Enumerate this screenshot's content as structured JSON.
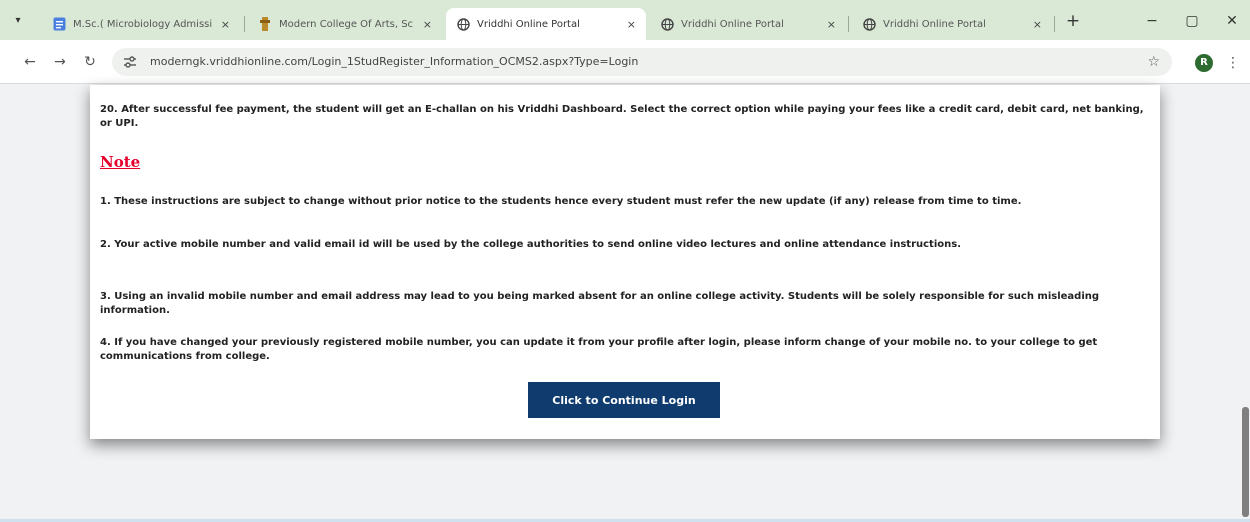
{
  "browser": {
    "tabs": [
      {
        "title": "M.Sc.( Microbiology Admissi",
        "favicon": "doc-icon"
      },
      {
        "title": "Modern College Of Arts, Sc",
        "favicon": "college-logo-icon"
      },
      {
        "title": "Vriddhi Online Portal",
        "favicon": "globe-icon",
        "active": true
      },
      {
        "title": "Vriddhi Online Portal",
        "favicon": "globe-icon"
      },
      {
        "title": "Vriddhi Online Portal",
        "favicon": "globe-icon"
      }
    ],
    "new_tab_label": "+",
    "tab_close_label": "×",
    "tab_dropdown_label": "▾",
    "minimize_label": "−",
    "maximize_label": "▢",
    "close_label": "✕",
    "back_label": "←",
    "forward_label": "→",
    "reload_label": "↻",
    "url": "moderngk.vriddhionline.com/Login_1StudRegister_Information_OCMS2.aspx?Type=Login",
    "bookmark_label": "☆",
    "profile_initial": "R",
    "menu_label": "⋮"
  },
  "content": {
    "item20": "20. After successful fee payment, the student will get an E-challan on his Vriddhi Dashboard. Select the correct option while paying your fees like a credit card, debit card, net banking, or UPI.",
    "note_heading": "Note",
    "notes": [
      "1. These instructions are subject to change without prior notice to the students hence every student must refer the new update (if any) release from time to time.",
      "2. Your active mobile number and valid email id will be used by the college authorities to send online video lectures and online attendance instructions.",
      "3. Using an invalid mobile number and email address may lead to you being marked absent for an online college activity. Students will be solely responsible for such misleading information.",
      "4. If you have changed your previously registered mobile number, you can update it from your profile after login, please inform change of your mobile no. to your college to get communications from college."
    ],
    "continue_button": "Click to Continue Login"
  },
  "colors": {
    "tab_strip": "#d9e9d6",
    "note_heading": "#e4002b",
    "button_bg": "#0f3b6e",
    "profile": "#2e6b30"
  }
}
